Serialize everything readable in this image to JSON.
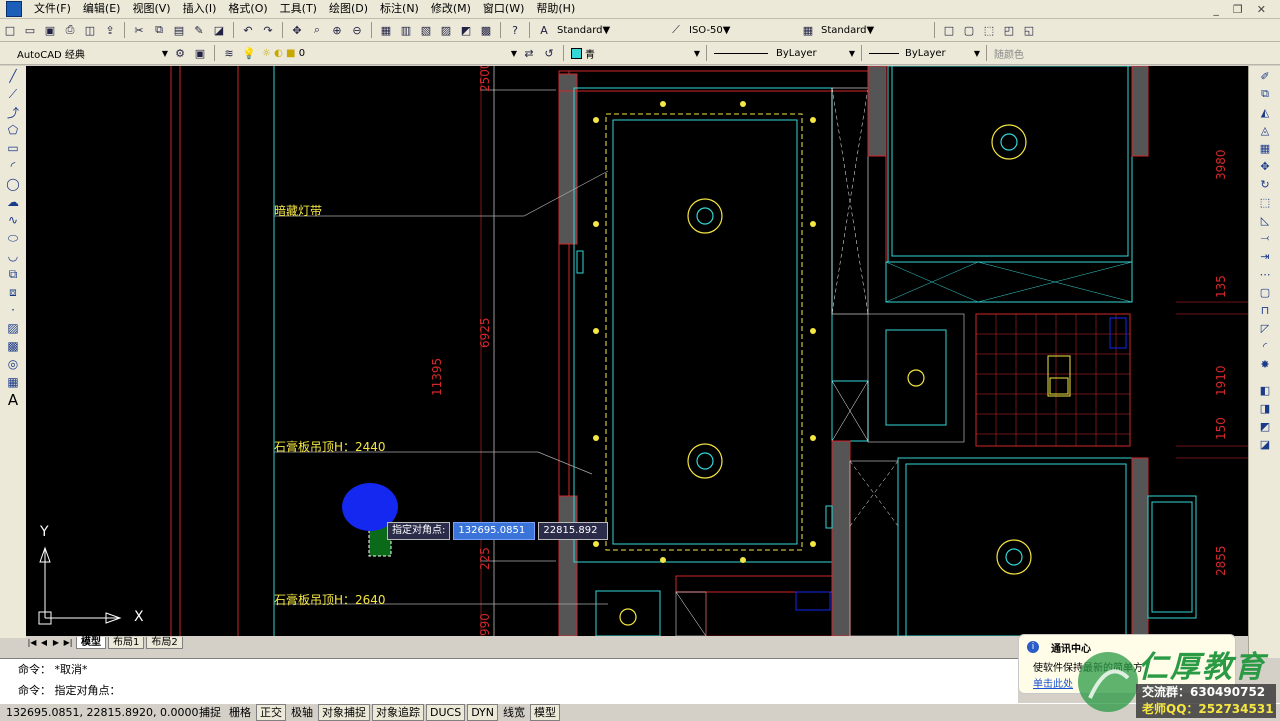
{
  "menu": [
    "文件(F)",
    "编辑(E)",
    "视图(V)",
    "插入(I)",
    "格式(O)",
    "工具(T)",
    "绘图(D)",
    "标注(N)",
    "修改(M)",
    "窗口(W)",
    "帮助(H)"
  ],
  "toolbar1": {
    "text_style": "Standard",
    "dim_style": "ISO-50",
    "table_style": "Standard"
  },
  "toolbar2": {
    "workspace": "AutoCAD 经典",
    "layer": "0",
    "color": "青",
    "linetype": "ByLayer",
    "lineweight": "ByLayer",
    "plotstyle": "随颜色"
  },
  "drawing": {
    "dims": [
      "2500",
      "6925",
      "11395",
      "3980",
      "135",
      "1910",
      "150",
      "2855",
      "225",
      "990"
    ],
    "labels": {
      "hidden_light": "暗藏灯带",
      "ceiling1": "石膏板吊顶H：2440",
      "ceiling2": "石膏板吊顶H：2640"
    },
    "tooltip": {
      "prompt": "指定对角点:",
      "x": "132695.0851",
      "y": "22815.892"
    },
    "ucs": {
      "x": "X",
      "y": "Y"
    }
  },
  "layout_tabs": [
    "模型",
    "布局1",
    "布局2"
  ],
  "command": {
    "line1": "命令： *取消*",
    "line2": "命令： 指定对角点："
  },
  "status": {
    "coords": "132695.0851, 22815.8920, 0.0000",
    "buttons": [
      "捕捉",
      "栅格",
      "正交",
      "极轴",
      "对象捕捉",
      "对象追踪",
      "DUCS",
      "DYN",
      "线宽",
      "模型"
    ]
  },
  "notification": {
    "title": "通讯中心",
    "body": "使软件保持最新的简单方",
    "link": "单击此处"
  },
  "watermark": {
    "brand": "仁厚教育",
    "group": "交流群：630490752",
    "qq": "老师QQ：252734531"
  },
  "colors": {
    "canvas": "#000000",
    "wall": "#d0282a",
    "cyan": "#34d6d6",
    "yellow": "#f5e642",
    "blue_marker": "#1428f0"
  }
}
